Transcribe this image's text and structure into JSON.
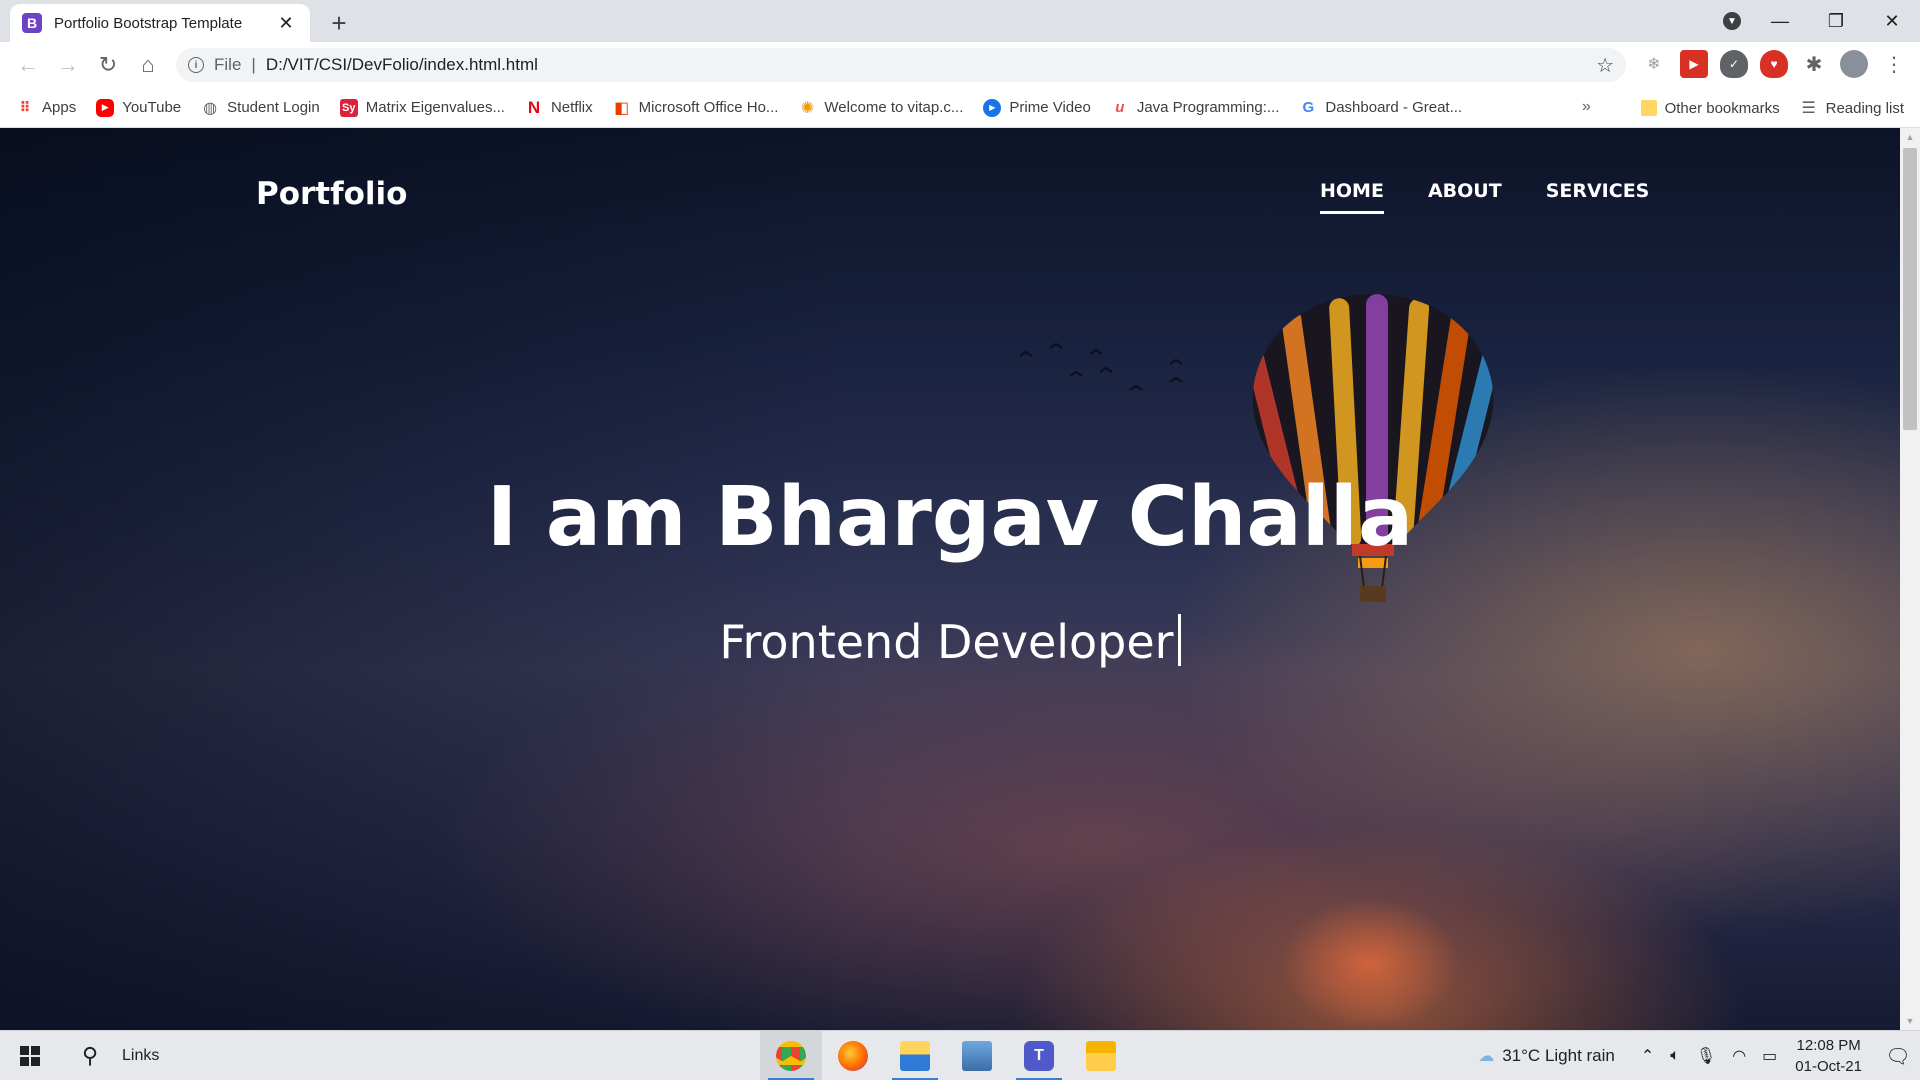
{
  "browser": {
    "tab": {
      "title": "Portfolio Bootstrap Template",
      "favicon_letter": "B",
      "favicon_color": "#6f42c1"
    },
    "window_controls": [
      "minimize-icon",
      "restore-icon",
      "close-icon"
    ],
    "address_bar": {
      "scheme_label": "File",
      "separator": "|",
      "url": "D:/VIT/CSI/DevFolio/index.html.html"
    },
    "bookmarks": [
      {
        "label": "Apps",
        "icon": "apps-grid-icon"
      },
      {
        "label": "YouTube",
        "icon": "youtube-icon"
      },
      {
        "label": "Student Login",
        "icon": "globe-icon"
      },
      {
        "label": "Matrix Eigenvalues...",
        "icon": "sy-icon"
      },
      {
        "label": "Netflix",
        "icon": "netflix-icon"
      },
      {
        "label": "Microsoft Office Ho...",
        "icon": "office-icon"
      },
      {
        "label": "Welcome to vitap.c...",
        "icon": "vitap-icon"
      },
      {
        "label": "Prime Video",
        "icon": "prime-video-icon"
      },
      {
        "label": "Java Programming:...",
        "icon": "udemy-icon"
      },
      {
        "label": "Dashboard - Great...",
        "icon": "google-icon"
      }
    ],
    "bookmarks_overflow": "»",
    "other_bookmarks": "Other bookmarks",
    "reading_list": "Reading list"
  },
  "site": {
    "brand": "Portfolio",
    "nav": [
      {
        "label": "HOME",
        "active": true
      },
      {
        "label": "ABOUT",
        "active": false
      },
      {
        "label": "SERVICES",
        "active": false
      }
    ],
    "hero_title": "I am Bhargav Challa",
    "hero_subtitle": "Frontend Developer"
  },
  "taskbar": {
    "search_label": "Links",
    "weather": {
      "temp": "31°C",
      "condition": "Light rain"
    },
    "clock": {
      "time": "12:08 PM",
      "date": "01-Oct-21"
    },
    "apps": [
      "chrome-icon",
      "firefox-icon",
      "file-explorer-icon",
      "laptop-icon",
      "teams-icon",
      "folder-icon"
    ]
  }
}
